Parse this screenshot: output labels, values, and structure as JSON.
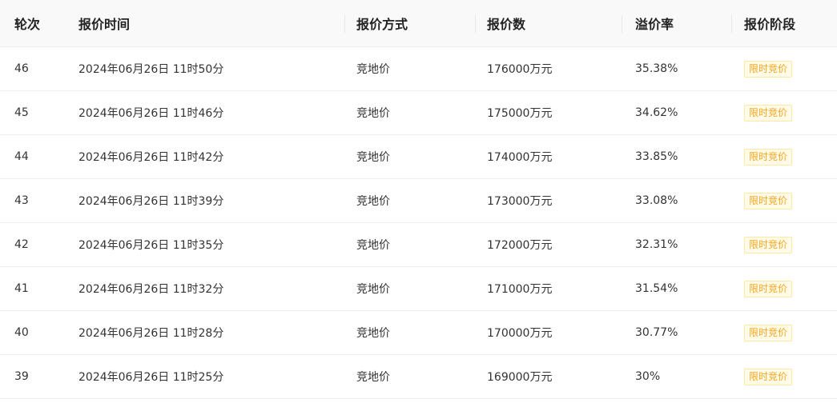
{
  "table": {
    "headers": [
      "轮次",
      "报价时间",
      "报价方式",
      "报价数",
      "溢价率",
      "报价阶段"
    ],
    "rows": [
      {
        "round": "46",
        "time": "2024年06月26日 11时50分",
        "method": "竞地价",
        "amount": "176000万元",
        "premium": "35.38%",
        "stage": "限时竞价"
      },
      {
        "round": "45",
        "time": "2024年06月26日 11时46分",
        "method": "竞地价",
        "amount": "175000万元",
        "premium": "34.62%",
        "stage": "限时竞价"
      },
      {
        "round": "44",
        "time": "2024年06月26日 11时42分",
        "method": "竞地价",
        "amount": "174000万元",
        "premium": "33.85%",
        "stage": "限时竞价"
      },
      {
        "round": "43",
        "time": "2024年06月26日 11时39分",
        "method": "竞地价",
        "amount": "173000万元",
        "premium": "33.08%",
        "stage": "限时竞价"
      },
      {
        "round": "42",
        "time": "2024年06月26日 11时35分",
        "method": "竞地价",
        "amount": "172000万元",
        "premium": "32.31%",
        "stage": "限时竞价"
      },
      {
        "round": "41",
        "time": "2024年06月26日 11时32分",
        "method": "竞地价",
        "amount": "171000万元",
        "premium": "31.54%",
        "stage": "限时竞价"
      },
      {
        "round": "40",
        "time": "2024年06月26日 11时28分",
        "method": "竞地价",
        "amount": "170000万元",
        "premium": "30.77%",
        "stage": "限时竞价"
      },
      {
        "round": "39",
        "time": "2024年06月26日 11时25分",
        "method": "竞地价",
        "amount": "169000万元",
        "premium": "30%",
        "stage": "限时竞价"
      }
    ]
  },
  "colors": {
    "header_bg": "#f9f9f9",
    "badge_text": "#f5a623",
    "badge_bg": "#fffbe6",
    "badge_border": "#fde9a6"
  }
}
